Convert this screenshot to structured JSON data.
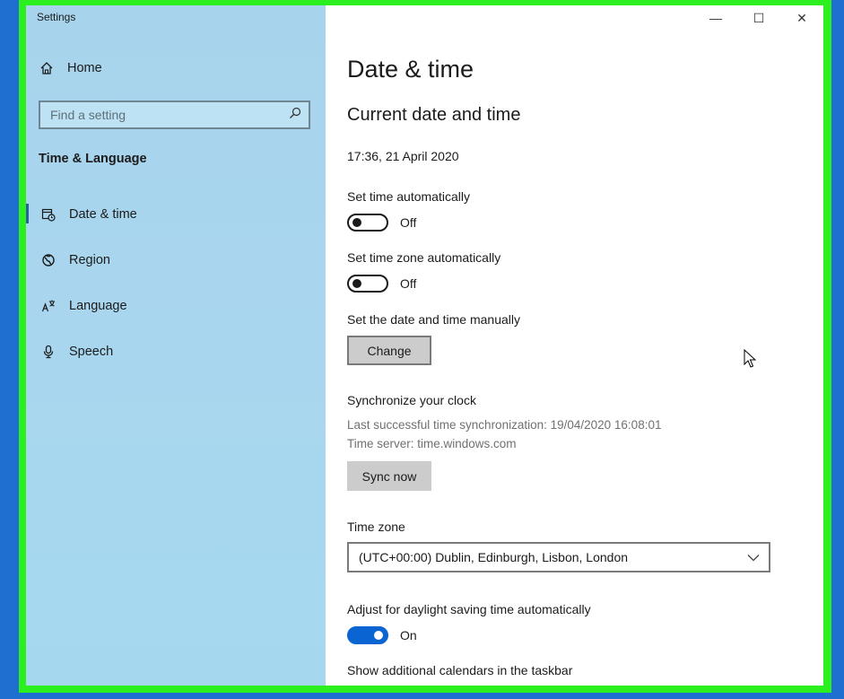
{
  "window": {
    "app_title": "Settings",
    "controls": {
      "minimize": "—",
      "maximize": "☐",
      "close": "✕"
    }
  },
  "sidebar": {
    "home_label": "Home",
    "search": {
      "placeholder": "Find a setting"
    },
    "section_title": "Time & Language",
    "items": [
      {
        "label": "Date & time",
        "icon": "calendar-clock-icon",
        "active": true
      },
      {
        "label": "Region",
        "icon": "globe-icon",
        "active": false
      },
      {
        "label": "Language",
        "icon": "language-icon",
        "active": false
      },
      {
        "label": "Speech",
        "icon": "microphone-icon",
        "active": false
      }
    ]
  },
  "main": {
    "page_title": "Date & time",
    "current_heading": "Current date and time",
    "current_value": "17:36, 21 April 2020",
    "set_time_auto": {
      "label": "Set time automatically",
      "state": "Off"
    },
    "set_tz_auto": {
      "label": "Set time zone automatically",
      "state": "Off"
    },
    "manual": {
      "label": "Set the date and time manually",
      "button": "Change"
    },
    "sync": {
      "heading": "Synchronize your clock",
      "last_sync": "Last successful time synchronization: 19/04/2020 16:08:01",
      "server": "Time server: time.windows.com",
      "button": "Sync now"
    },
    "timezone": {
      "label": "Time zone",
      "value": "(UTC+00:00) Dublin, Edinburgh, Lisbon, London"
    },
    "dst": {
      "label": "Adjust for daylight saving time automatically",
      "state": "On"
    },
    "calendars_label": "Show additional calendars in the taskbar"
  },
  "colors": {
    "accent": "#0a64d2",
    "frame_highlight": "#2bef1e",
    "sidebar_bg": "#a9d6ee",
    "desktop": "#1f6fd1"
  }
}
